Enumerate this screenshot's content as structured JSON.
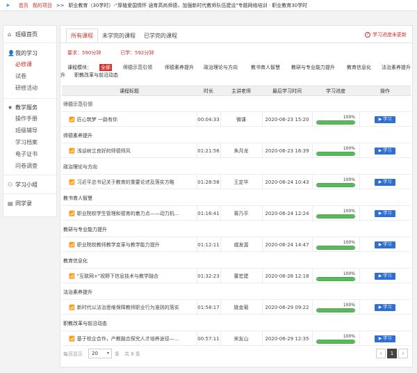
{
  "breadcrumb": {
    "home": "首页",
    "my_project": "我的项目",
    "separator": ">>",
    "path": "职业教育（30学时）-\"厚植爱国情怀 涵育高尚师德，加强新时代教师队伍建设\"专题网络培训 · 职业教育30学时"
  },
  "sidebar": {
    "class_home": "班级首页",
    "my_study": "我的学习",
    "my_study_items": [
      "必修课",
      "试卷",
      "研修活动"
    ],
    "teaching_service": "教学服务",
    "teaching_items": [
      "操作手册",
      "班级辅导",
      "学习档案",
      "电子证书",
      "问卷调查"
    ],
    "study_group": "学习小组",
    "classmates": "同学录"
  },
  "tabs": [
    "所有课程",
    "未学完的课程",
    "已学完的课程"
  ],
  "refresh_note": "学习进度未更新",
  "requirements": {
    "required": "要求：590分钟",
    "completed": "已学：592分钟"
  },
  "modules": {
    "label": "课程模块：",
    "items": [
      "全部",
      "师德示范引领",
      "师德素养提升",
      "政治理论与方向",
      "教书育人智慧",
      "教研与专业能力提升",
      "教育信息化",
      "法治素养提升",
      "职教改革与前沿动态"
    ],
    "wrap_tail": "升"
  },
  "table": {
    "headers": [
      "课程标题",
      "时长",
      "主讲老师",
      "最后学习时间",
      "学习进度",
      "操作"
    ],
    "button_label": "学习",
    "groups": [
      {
        "name": "师德示范引领",
        "rows": [
          {
            "title": "匠心筑梦 一路有你",
            "duration": "00:04:33",
            "teacher": "微课",
            "last": "2020-06-23 15:20",
            "progress": "100%"
          }
        ]
      },
      {
        "name": "师德素养提升",
        "rows": [
          {
            "title": "浅谈树立良好的师德师风",
            "duration": "01:21:56",
            "teacher": "朱月龙",
            "last": "2020-06-23 16:39",
            "progress": "100%"
          }
        ]
      },
      {
        "name": "政治理论与方向",
        "rows": [
          {
            "title": "习近平总书记关于教育的重要论述及落实方略",
            "duration": "01:28:58",
            "teacher": "王定华",
            "last": "2020-06-24 10:43",
            "progress": "100%"
          }
        ]
      },
      {
        "name": "教书育人智慧",
        "rows": [
          {
            "title": "职业院校学生管理和德育的着力点——动力机...",
            "duration": "01:16:41",
            "teacher": "蒋乃平",
            "last": "2020-06-24 12:24",
            "progress": "100%"
          }
        ]
      },
      {
        "name": "教研与专业能力提升",
        "rows": [
          {
            "title": "职业院校教师教学变革与教学能力提升",
            "duration": "01:12:11",
            "teacher": "戚发渥",
            "last": "2020-06-24 14:47",
            "progress": "100%"
          }
        ]
      },
      {
        "name": "教育信息化",
        "rows": [
          {
            "title": "\"互联网+\"视野下信息技术与教学融合",
            "duration": "01:32:23",
            "teacher": "董宏建",
            "last": "2020-06-28 12:18",
            "progress": "100%"
          }
        ]
      },
      {
        "name": "法治素养提升",
        "rows": [
          {
            "title": "新时代以法治思维保障教师职业行为准则的落实",
            "duration": "01:58:17",
            "teacher": "姚金菊",
            "last": "2020-06-29 09:22",
            "progress": "100%"
          }
        ]
      },
      {
        "name": "职教改革与前沿动态",
        "rows": [
          {
            "title": "基于校企合作，产教融合探究人才培养途径—...",
            "duration": "00:57:11",
            "teacher": "宋友山",
            "last": "2020-06-29 12:35",
            "progress": "100%"
          }
        ]
      }
    ]
  },
  "footer": {
    "per_page_label": "每页显示",
    "per_page_value": "20",
    "items_label": "条",
    "total_label": "共 8 条",
    "current_page": "1"
  },
  "colors": {
    "accent_red": "#d0322b",
    "button_blue": "#2f6fd1",
    "progress_green": "#5cb85c"
  },
  "icons": {
    "send": "paper-plane-icon",
    "home": "home-icon",
    "user": "user-icon",
    "star": "star-icon",
    "group": "group-icon",
    "contacts": "contacts-icon",
    "help": "question-circle-icon",
    "stream": "wifi-icon"
  }
}
